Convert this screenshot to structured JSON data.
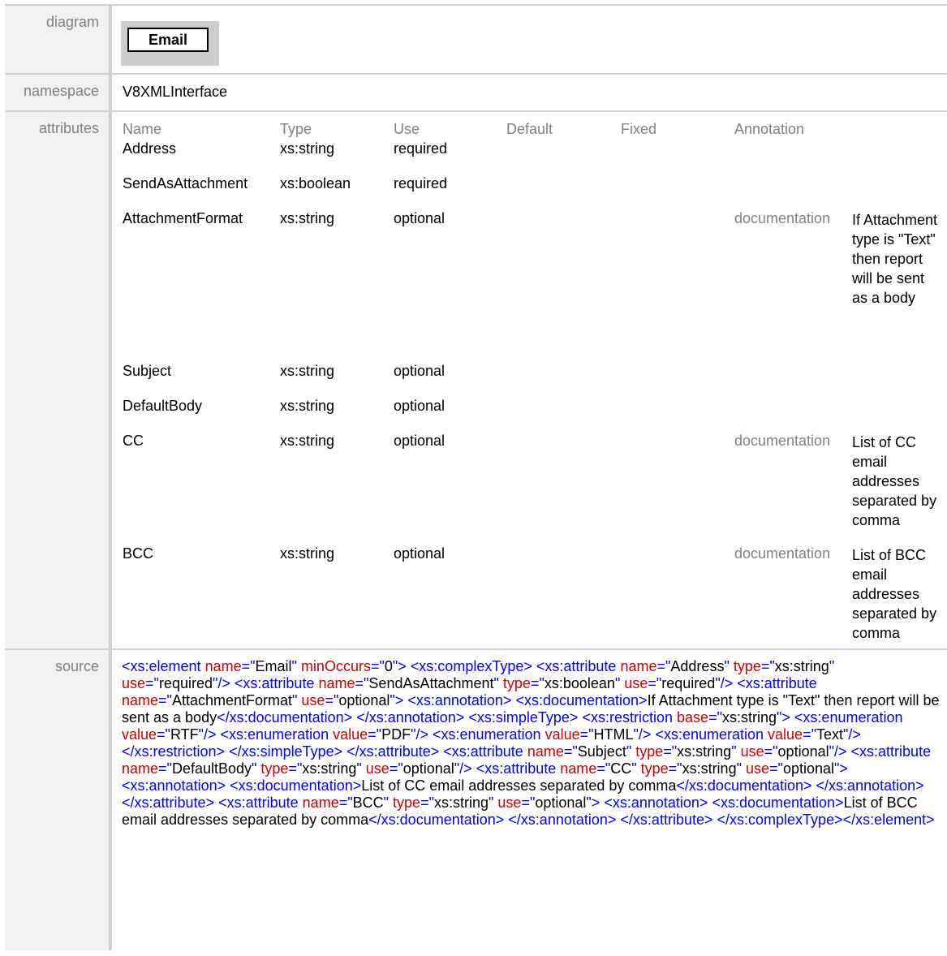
{
  "diagram": {
    "label": "diagram",
    "element_name": "Email"
  },
  "namespace": {
    "label": "namespace",
    "value": "V8XMLInterface"
  },
  "attributes": {
    "label": "attributes",
    "headers": [
      "Name",
      "Type",
      "Use",
      "Default",
      "Fixed",
      "Annotation"
    ],
    "rows": [
      {
        "name": "Address",
        "type": "xs:string",
        "use": "required"
      },
      {
        "name": "SendAsAttachment",
        "type": "xs:boolean",
        "use": "required"
      },
      {
        "name": "AttachmentFormat",
        "type": "xs:string",
        "use": "optional",
        "annotation_key": "documentation",
        "annotation": "If Attachment type is \"Text\" then report will be sent as a body"
      },
      {
        "name": "Subject",
        "type": "xs:string",
        "use": "optional"
      },
      {
        "name": "DefaultBody",
        "type": "xs:string",
        "use": "optional"
      },
      {
        "name": "CC",
        "type": "xs:string",
        "use": "optional",
        "annotation_key": "documentation",
        "annotation": "List of CC email addresses separated by comma"
      },
      {
        "name": "BCC",
        "type": "xs:string",
        "use": "optional",
        "annotation_key": "documentation",
        "annotation": "List of BCC email addresses separated by comma"
      }
    ]
  },
  "source": {
    "label": "source",
    "code": "<xs:element name=\"Email\" minOccurs=\"0\"> <xs:complexType> <xs:attribute name=\"Address\" type=\"xs:string\" use=\"required\"/> <xs:attribute name=\"SendAsAttachment\" type=\"xs:boolean\" use=\"required\"/> <xs:attribute name=\"AttachmentFormat\" use=\"optional\"> <xs:annotation> <xs:documentation>If Attachment type is \"Text\" then report will be sent as a body</xs:documentation> </xs:annotation> <xs:simpleType> <xs:restriction base=\"xs:string\"> <xs:enumeration value=\"RTF\"/> <xs:enumeration value=\"PDF\"/> <xs:enumeration value=\"HTML\"/> <xs:enumeration value=\"Text\"/> </xs:restriction> </xs:simpleType> </xs:attribute> <xs:attribute name=\"Subject\" type=\"xs:string\" use=\"optional\"/> <xs:attribute name=\"DefaultBody\" type=\"xs:string\" use=\"optional\"/> <xs:attribute name=\"CC\" type=\"xs:string\" use=\"optional\"> <xs:annotation> <xs:documentation>List of CC email addresses separated by comma</xs:documentation> </xs:annotation> </xs:attribute> <xs:attribute name=\"BCC\" type=\"xs:string\" use=\"optional\"> <xs:annotation> <xs:documentation>List of BCC email addresses separated by comma</xs:documentation> </xs:annotation> </xs:attribute> </xs:complexType></xs:element>"
  },
  "colors": {
    "tag": "#0000ff",
    "attr_name": "#cc0000",
    "label_gray": "#808080",
    "label_bg": "#f1f1f1",
    "border": "#cfcfcf"
  }
}
